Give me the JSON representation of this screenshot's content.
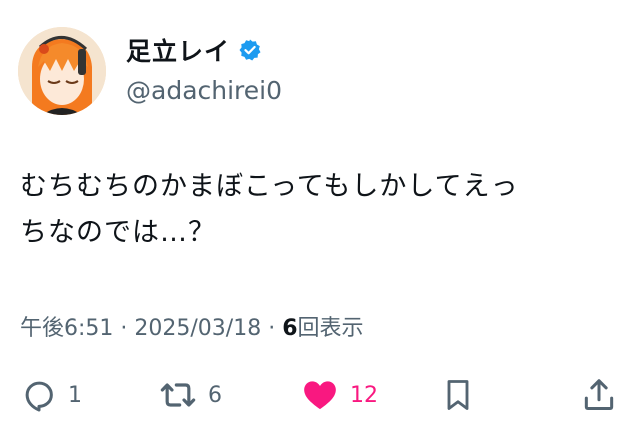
{
  "user": {
    "display_name": "足立レイ",
    "handle": "@adachirei0",
    "verified": true
  },
  "tweet": {
    "text_line1": "むちむちのかまぼこってもしかしてえっ",
    "text_line2": "ちなのでは…？"
  },
  "meta": {
    "time": "午後6:51",
    "separator": " · ",
    "date": "2025/03/18",
    "views_count": "6",
    "views_label": "回表示"
  },
  "actions": {
    "replies": "1",
    "retweets": "6",
    "likes": "12",
    "like_color": "#f91880",
    "icon_color": "#536471"
  },
  "colors": {
    "verified_badge": "#1d9bf0",
    "avatar_hair": "#f47a1f"
  }
}
